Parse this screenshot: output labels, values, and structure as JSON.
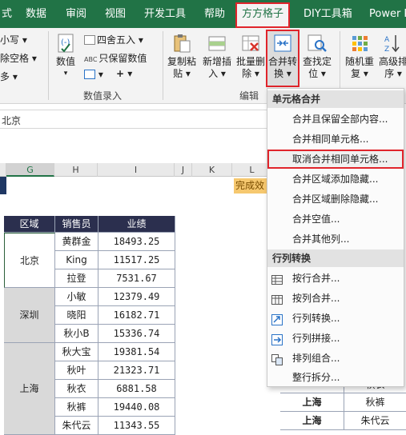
{
  "ribbon_tabs": [
    {
      "label": "式"
    },
    {
      "label": "数据"
    },
    {
      "label": "审阅"
    },
    {
      "label": "视图"
    },
    {
      "label": "开发工具"
    },
    {
      "label": "帮助"
    },
    {
      "label": "方方格子"
    },
    {
      "label": "DIY工具箱"
    },
    {
      "label": "Power P"
    }
  ],
  "ribbon": {
    "small_case": "小写",
    "remove_space": "除空格",
    "more": "多",
    "value_btn": "数值",
    "round_btn": "四舍五入",
    "keep_value_btn": "只保留数值",
    "plus": "+",
    "group_number_entry": "数值录入",
    "copy_paste": [
      "复制粘",
      "贴"
    ],
    "new_insert": [
      "新增插",
      "入"
    ],
    "batch_delete": [
      "批量删",
      "除"
    ],
    "merge_convert": [
      "合并转",
      "换"
    ],
    "find_locate": [
      "查找定",
      "位"
    ],
    "random_repeat": [
      "随机重",
      "复"
    ],
    "advanced_sort": [
      "高级排",
      "序"
    ],
    "group_edit": "编辑"
  },
  "formula_bar": {
    "value": "北京"
  },
  "columns": [
    "G",
    "H",
    "I",
    "J",
    "K",
    "L"
  ],
  "status_banner": "完成效",
  "table": {
    "headers": [
      "区域",
      "销售员",
      "业绩"
    ],
    "regions": [
      {
        "name": "北京",
        "rows": 3
      },
      {
        "name": "深圳",
        "rows": 3
      },
      {
        "name": "上海",
        "rows": 5
      }
    ],
    "rows": [
      {
        "seller": "黄群金",
        "amount": "18493.25"
      },
      {
        "seller": "King",
        "amount": "11517.25"
      },
      {
        "seller": "拉登",
        "amount": "7531.67"
      },
      {
        "seller": "小敏",
        "amount": "12379.49"
      },
      {
        "seller": "晓阳",
        "amount": "16182.71"
      },
      {
        "seller": "秋小B",
        "amount": "15336.74"
      },
      {
        "seller": "秋大宝",
        "amount": "19381.54"
      },
      {
        "seller": "秋叶",
        "amount": "21323.71"
      },
      {
        "seller": "秋衣",
        "amount": "6881.58"
      },
      {
        "seller": "秋裤",
        "amount": "19440.08"
      },
      {
        "seller": "朱代云",
        "amount": "11343.55"
      }
    ]
  },
  "right_table": {
    "rows": [
      {
        "region": "",
        "seller": "秋衣"
      },
      {
        "region": "上海",
        "seller": "秋裤"
      },
      {
        "region": "上海",
        "seller": "朱代云"
      }
    ]
  },
  "menu": {
    "section1": "单元格合并",
    "group1": [
      "合并且保留全部内容...",
      "合并相同单元格...",
      "取消合并相同单元格...",
      "合并区域添加隐藏...",
      "合并区域删除隐藏...",
      "合并空值...",
      "合并其他列..."
    ],
    "section2": "行列转换",
    "group2": [
      "按行合并...",
      "按列合并...",
      "行列转换...",
      "行列拼接...",
      "排列组合...",
      "整行拆分..."
    ]
  },
  "colors": {
    "ribbon_green": "#217346",
    "header_navy": "#2b2f4e",
    "highlight_red": "#e0242b",
    "banner_orange": "#f6c86f"
  }
}
